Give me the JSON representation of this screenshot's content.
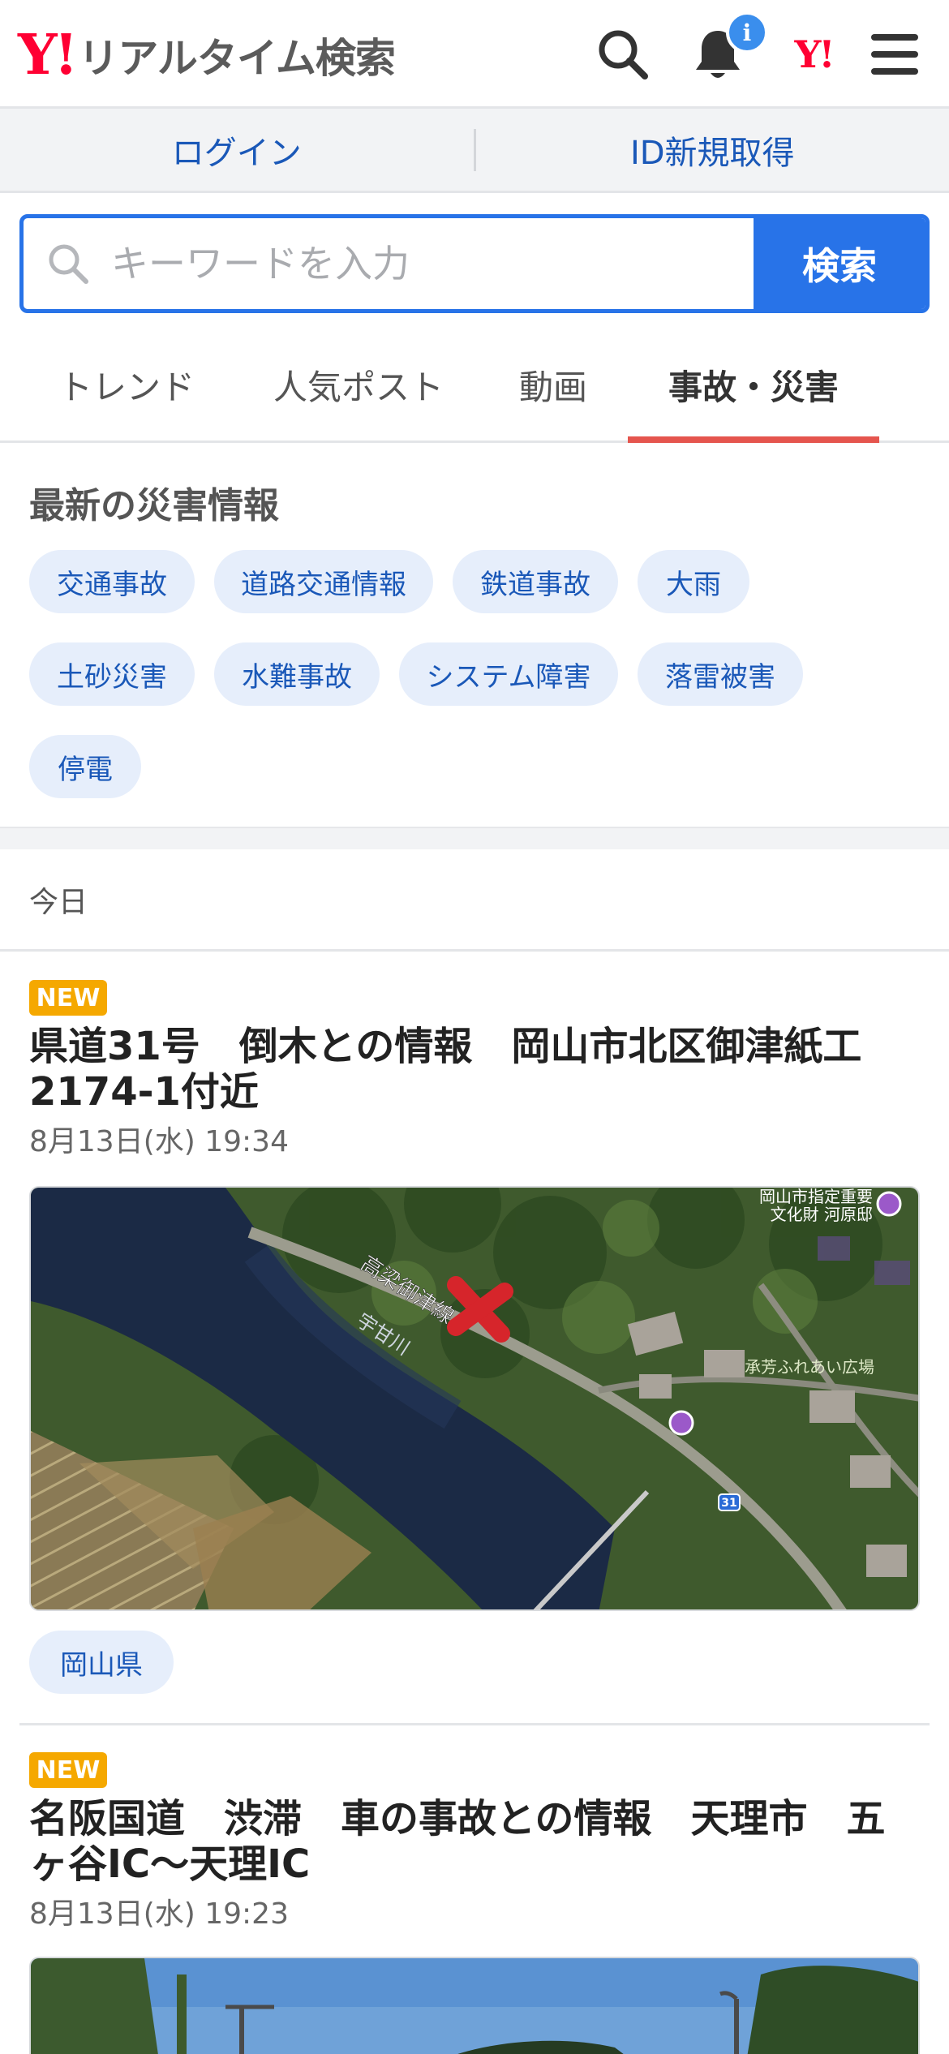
{
  "header": {
    "logo_mark": "Y!",
    "logo_title": "リアルタイム検索",
    "notification_badge": "i",
    "yj_mark": "Y!"
  },
  "account": {
    "login_label": "ログイン",
    "signup_label": "ID新規取得"
  },
  "search": {
    "placeholder": "キーワードを入力",
    "value": "",
    "button_label": "検索"
  },
  "tabs": [
    {
      "label": "トレンド"
    },
    {
      "label": "人気ポスト"
    },
    {
      "label": "動画"
    },
    {
      "label": "事故・災害"
    }
  ],
  "active_tab": "事故・災害",
  "disaster": {
    "title": "最新の災害情報",
    "categories": [
      "交通事故",
      "道路交通情報",
      "鉄道事故",
      "大雨",
      "土砂災害",
      "水難事故",
      "システム障害",
      "落雷被害",
      "停電"
    ]
  },
  "section_label": "今日",
  "articles": [
    {
      "badge": "NEW",
      "title": "県道31号　倒木との情報　岡山市北区御津紙工2174-1付近",
      "time": "8月13日(水) 19:34",
      "prefecture": "岡山県",
      "map_labels": {
        "road": "高梁御津線",
        "river": "宇甘川",
        "poi1": "岡山市指定重要",
        "poi1b": "文化財 河原邸",
        "poi2": "承芳ふれあい広場",
        "route_no": "31"
      }
    },
    {
      "badge": "NEW",
      "title": "名阪国道　渋滞　車の事故との情報　天理市　五ヶ谷IC～天理IC",
      "time": "8月13日(水) 19:23"
    }
  ],
  "colors": {
    "brand_red": "#ff0033",
    "accent_blue": "#2873e8",
    "link_blue": "#1a58b8",
    "tab_indicator": "#e5554e",
    "new_badge": "#f5a800"
  }
}
